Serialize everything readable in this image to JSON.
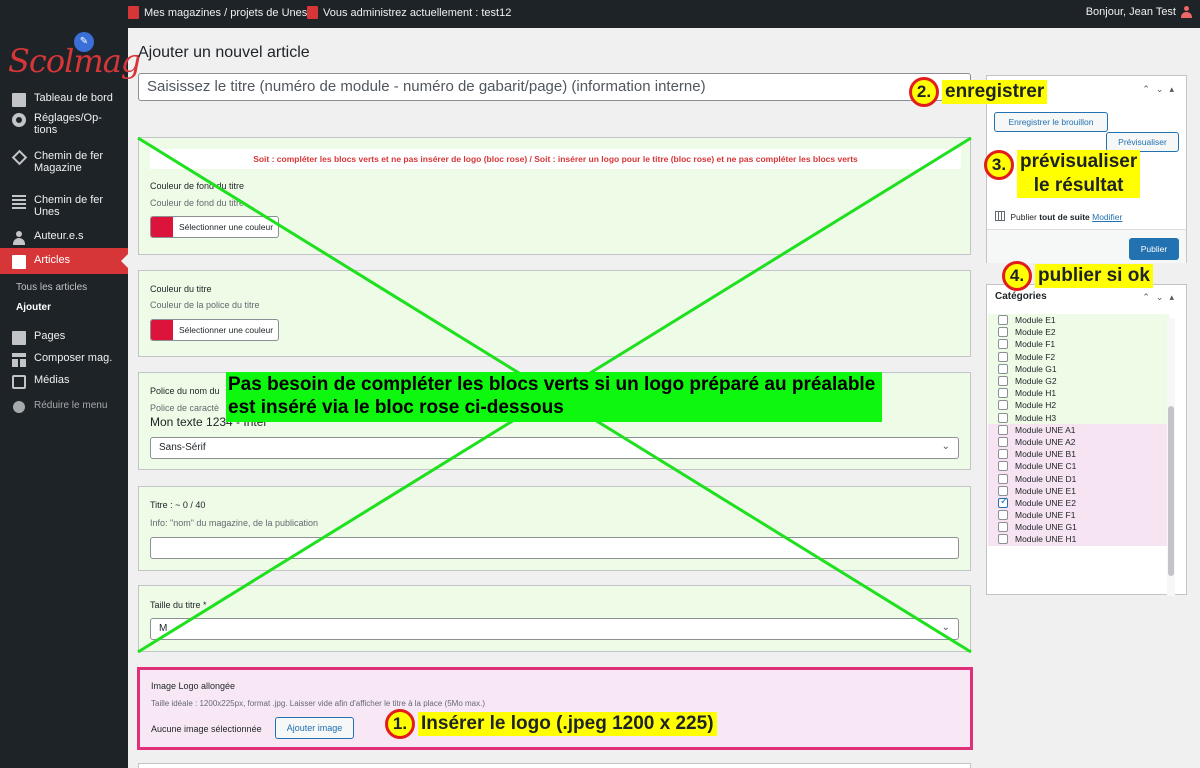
{
  "adminbar": {
    "item1": "Mes magazines / projets de Unes",
    "item2": "Vous administrez actuellement : test12",
    "greeting": "Bonjour, Jean Test"
  },
  "sidebar": {
    "logo": "Scolmag",
    "items": [
      {
        "label": "Tableau de bord",
        "icon": "dashboard-icon"
      },
      {
        "label": "Réglages/Op-\ntions",
        "icon": "settings-icon"
      },
      {
        "label": "Chemin de fer\nMagazine",
        "icon": "magazine-icon"
      },
      {
        "label": "Chemin de fer\nUnes",
        "icon": "unes-icon"
      },
      {
        "label": "Auteur.e.s",
        "icon": "authors-icon"
      },
      {
        "label": "Articles",
        "icon": "articles-icon"
      },
      {
        "label": "Pages",
        "icon": "pages-icon"
      },
      {
        "label": "Composer mag.",
        "icon": "compose-icon"
      },
      {
        "label": "Médias",
        "icon": "media-icon"
      },
      {
        "label": "Réduire le menu",
        "icon": "collapse-icon"
      }
    ],
    "submenu": [
      "Tous les articles",
      "Ajouter"
    ]
  },
  "main": {
    "page_title": "Ajouter un nouvel article",
    "title_placeholder": "Saisissez le titre (numéro de module - numéro de gabarit/page) (information interne)",
    "warning": "Soit : compléter les blocs verts et ne pas insérer de logo (bloc rose) / Soit : insérer un logo pour le titre (bloc rose) et ne pas compléter les blocs verts",
    "bg_color": {
      "label": "Couleur de fond du titre",
      "desc": "Couleur de fond du titre",
      "button": "Sélectionner une couleur",
      "swatch": "#dc143c"
    },
    "title_color": {
      "label": "Couleur du titre",
      "desc": "Couleur de la police du titre",
      "button": "Sélectionner une couleur",
      "swatch": "#dc143c"
    },
    "font": {
      "label": "Police du nom du",
      "desc": "Police de caractè",
      "sample": "Mon texte 1234 - Inter",
      "value": "Sans-Sérif"
    },
    "title_field": {
      "label": "Titre : ~ 0 / 40",
      "desc": "Info: \"nom\" du magazine, de la publication",
      "value": ""
    },
    "size": {
      "label": "Taille du titre *",
      "value": "M"
    },
    "logo": {
      "label": "Image Logo allongée",
      "desc": "Taille idéale : 1200x225px, format .jpg. Laisser vide afin d'afficher le titre à la place (5Mo max.)",
      "none": "Aucune image sélectionnée",
      "button": "Ajouter image"
    }
  },
  "publish": {
    "draft": "Enregistrer le brouillon",
    "preview": "Prévisualiser",
    "publish_prefix": "Publier",
    "publish_when": "tout de suite",
    "modify": "Modifier",
    "publish_button": "Publier"
  },
  "categories": {
    "title": "Catégories",
    "items": [
      {
        "label": "Module E1",
        "group": "green",
        "checked": false
      },
      {
        "label": "Module E2",
        "group": "green",
        "checked": false
      },
      {
        "label": "Module F1",
        "group": "green",
        "checked": false
      },
      {
        "label": "Module F2",
        "group": "green",
        "checked": false
      },
      {
        "label": "Module G1",
        "group": "green",
        "checked": false
      },
      {
        "label": "Module G2",
        "group": "green",
        "checked": false
      },
      {
        "label": "Module H1",
        "group": "green",
        "checked": false
      },
      {
        "label": "Module H2",
        "group": "green",
        "checked": false
      },
      {
        "label": "Module H3",
        "group": "green",
        "checked": false
      },
      {
        "label": "Module UNE A1",
        "group": "pink",
        "checked": false
      },
      {
        "label": "Module UNE A2",
        "group": "pink",
        "checked": false
      },
      {
        "label": "Module UNE B1",
        "group": "pink",
        "checked": false
      },
      {
        "label": "Module UNE C1",
        "group": "pink",
        "checked": false
      },
      {
        "label": "Module UNE D1",
        "group": "pink",
        "checked": false
      },
      {
        "label": "Module UNE E1",
        "group": "pink",
        "checked": false
      },
      {
        "label": "Module UNE E2",
        "group": "pink",
        "checked": true
      },
      {
        "label": "Module UNE F1",
        "group": "pink",
        "checked": false
      },
      {
        "label": "Module UNE G1",
        "group": "pink",
        "checked": false
      },
      {
        "label": "Module UNE H1",
        "group": "pink",
        "checked": false
      }
    ]
  },
  "annotations": {
    "note": "Pas besoin de compléter les blocs verts si un logo préparé au préalable est inséré via le bloc rose ci-dessous",
    "a1": {
      "num": "1.",
      "text": "Insérer le logo (.jpeg 1200 x 225)"
    },
    "a2": {
      "num": "2.",
      "text": "enregistrer"
    },
    "a3": {
      "num": "3.",
      "text": "prévisualiser\nle résultat"
    },
    "a4": {
      "num": "4.",
      "text": "publier si ok"
    }
  },
  "colors": {
    "accent": "#d63638",
    "primary": "#2271b1",
    "green_block": "#eefbe6",
    "pink_block": "#f8e8f5",
    "highlight": "#ffff00",
    "cross": "#1ee01e"
  }
}
